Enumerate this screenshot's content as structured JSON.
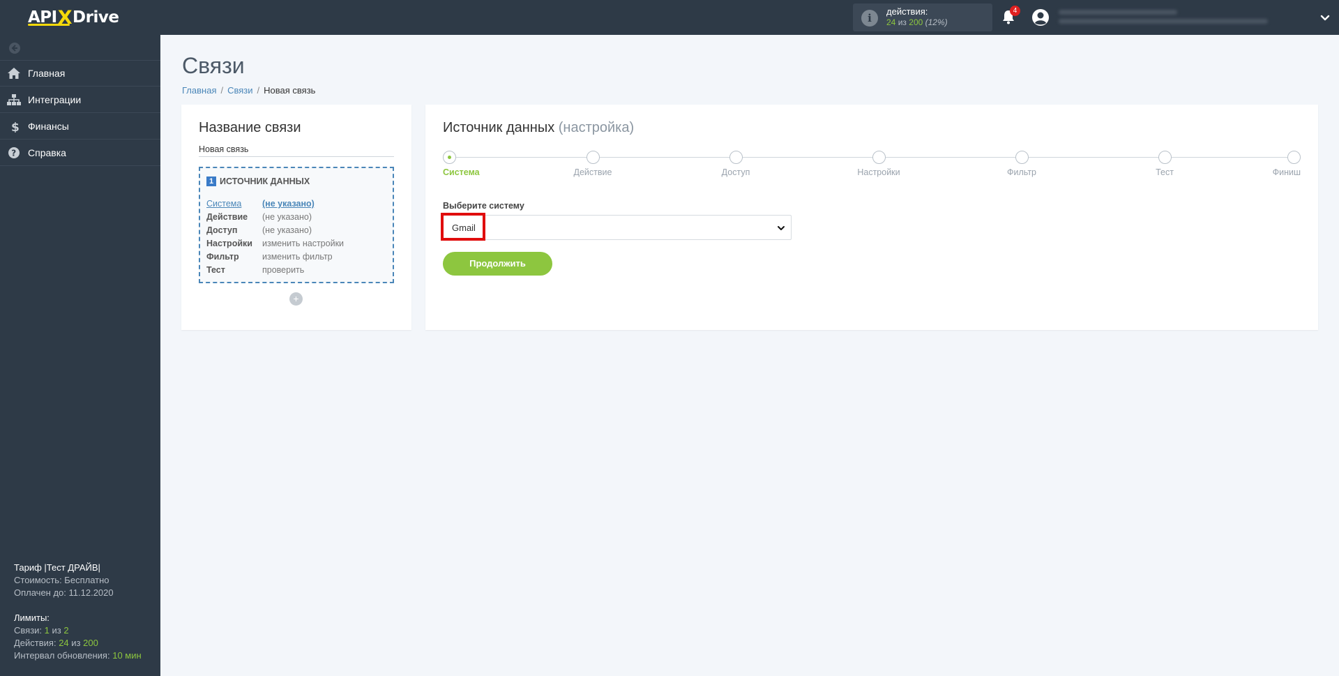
{
  "logo": {
    "part1": "API",
    "x": "X",
    "part2": "Drive"
  },
  "header": {
    "actions_label": "действия:",
    "actions_used": "24",
    "actions_of": "из",
    "actions_total": "200",
    "actions_percent": "(12%)",
    "notifications_count": "4"
  },
  "sidebar": {
    "items": [
      {
        "label": "Главная",
        "icon": "home-icon"
      },
      {
        "label": "Интеграции",
        "icon": "sitemap-icon"
      },
      {
        "label": "Финансы",
        "icon": "dollar-icon"
      },
      {
        "label": "Справка",
        "icon": "question-icon"
      }
    ],
    "tariff": {
      "title": "Тариф |Тест ДРАЙВ|",
      "cost": "Стоимость: Бесплатно",
      "paid_until": "Оплачен до: 11.12.2020",
      "limits_title": "Лимиты:",
      "links_label": "Связи:",
      "links_used": "1",
      "links_of": "из",
      "links_total": "2",
      "actions_label": "Действия:",
      "actions_used": "24",
      "actions_of": "из",
      "actions_total": "200",
      "interval_label": "Интервал обновления:",
      "interval_value": "10 мин"
    }
  },
  "page": {
    "title": "Связи",
    "breadcrumb": [
      "Главная",
      "Связи",
      "Новая связь"
    ]
  },
  "left_card": {
    "title": "Название связи",
    "name_value": "Новая связь",
    "source_number": "1",
    "source_title": "ИСТОЧНИК ДАННЫХ",
    "rows": [
      {
        "key": "Система",
        "value": "(не указано)"
      },
      {
        "key": "Действие",
        "value": "(не указано)"
      },
      {
        "key": "Доступ",
        "value": "(не указано)"
      },
      {
        "key": "Настройки",
        "value": "изменить настройки"
      },
      {
        "key": "Фильтр",
        "value": "изменить фильтр"
      },
      {
        "key": "Тест",
        "value": "проверить"
      }
    ],
    "add_label": "+"
  },
  "right_card": {
    "title": "Источник данных",
    "subtitle": "(настройка)",
    "steps": [
      "Система",
      "Действие",
      "Доступ",
      "Настройки",
      "Фильтр",
      "Тест",
      "Финиш"
    ],
    "active_step": 0,
    "select_label": "Выберите систему",
    "select_value": "Gmail",
    "continue_label": "Продолжить"
  },
  "colors": {
    "accent_green": "#8dc63f",
    "sidebar_bg": "#2e3a47",
    "link_blue": "#4a86b8",
    "highlight_red": "#e00d0d",
    "logo_yellow": "#f5d90a"
  }
}
